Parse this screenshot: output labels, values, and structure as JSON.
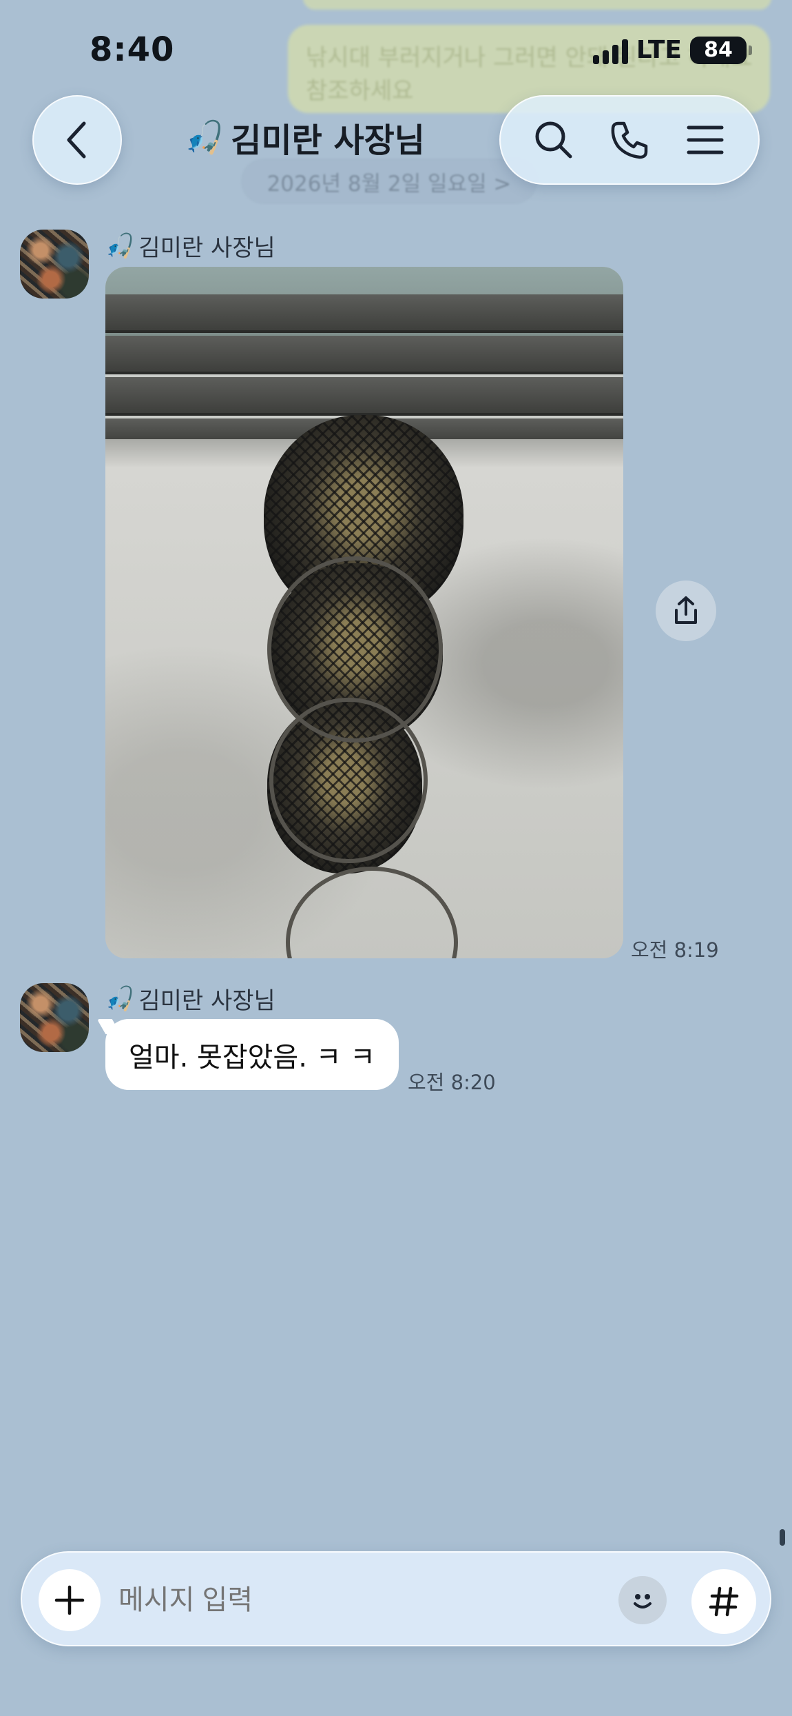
{
  "status_bar": {
    "time": "8:40",
    "network": "LTE",
    "battery": "84"
  },
  "background_context": {
    "previous_message": "낚시대 부러지거나 그러면 안돼 된다고 하네요 참조하세요",
    "date_divider": "2026년 8월 2일 일요일 >"
  },
  "header": {
    "title_emoji": "🎣",
    "title": "김미란 사장님",
    "back_icon": "chevron-left-icon",
    "actions": [
      "search-icon",
      "phone-icon",
      "menu-icon"
    ]
  },
  "messages": [
    {
      "type": "image",
      "sender_emoji": "🎣",
      "sender": "김미란 사장님",
      "image_icon": "fish-net-photo",
      "share_icon": "share-icon",
      "time": "오전 8:19"
    },
    {
      "type": "text",
      "sender_emoji": "🎣",
      "sender": "김미란 사장님",
      "text": "얼마. 못잡았음. ㅋ ㅋ",
      "time": "오전 8:20"
    }
  ],
  "input": {
    "placeholder": "메시지 입력",
    "add_icon": "plus-icon",
    "emoji_icon": "smile-icon",
    "hash_icon": "hash-icon"
  },
  "colors": {
    "background": "#aabfd2",
    "bubble": "#ffffff",
    "glass": "#deeefc"
  }
}
